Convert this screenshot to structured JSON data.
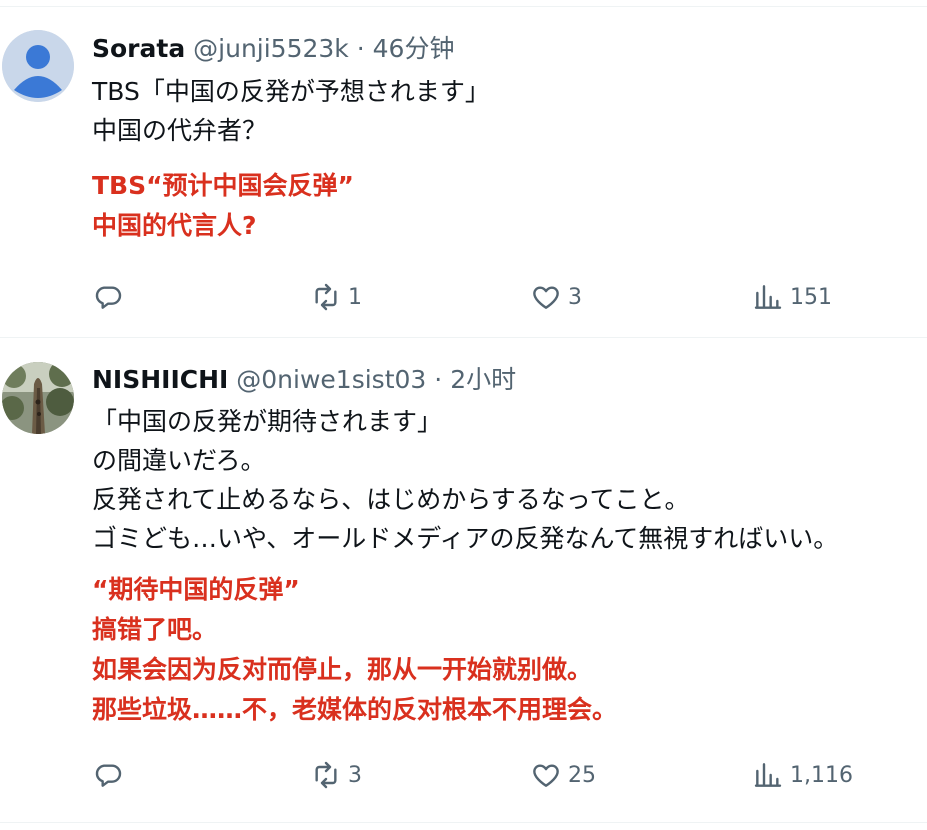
{
  "tweets": [
    {
      "name": "Sorata",
      "handle": "@junji5523k",
      "time": "46分钟",
      "lines": [
        "TBS「中国の反発が予想されます」",
        "中国の代弁者？"
      ],
      "translation": [
        "TBS“预计中国会反弹”",
        "中国的代言人?"
      ],
      "stats": {
        "replies": "",
        "retweets": "1",
        "likes": "3",
        "views": "151"
      }
    },
    {
      "name": "NISHIICHI",
      "handle": "@0niwe1sist03",
      "time": "2小时",
      "lines": [
        "「中国の反発が期待されます」",
        "の間違いだろ。",
        "反発されて止めるなら、はじめからするなってこと。",
        "ゴミども…いや、オールドメディアの反発なんて無視すればいい。"
      ],
      "translation": [
        "“期待中国的反弹”",
        "搞错了吧。",
        "如果会因为反对而停止，那从一开始就别做。",
        "那些垃圾……不，老媒体的反对根本不用理会。"
      ],
      "stats": {
        "replies": "",
        "retweets": "3",
        "likes": "25",
        "views": "1,116"
      }
    }
  ],
  "separator": "·",
  "icons": [
    "reply-icon",
    "retweet-icon",
    "like-icon",
    "views-icon"
  ],
  "colors": {
    "translation": "#d9301e",
    "meta": "#536471"
  }
}
